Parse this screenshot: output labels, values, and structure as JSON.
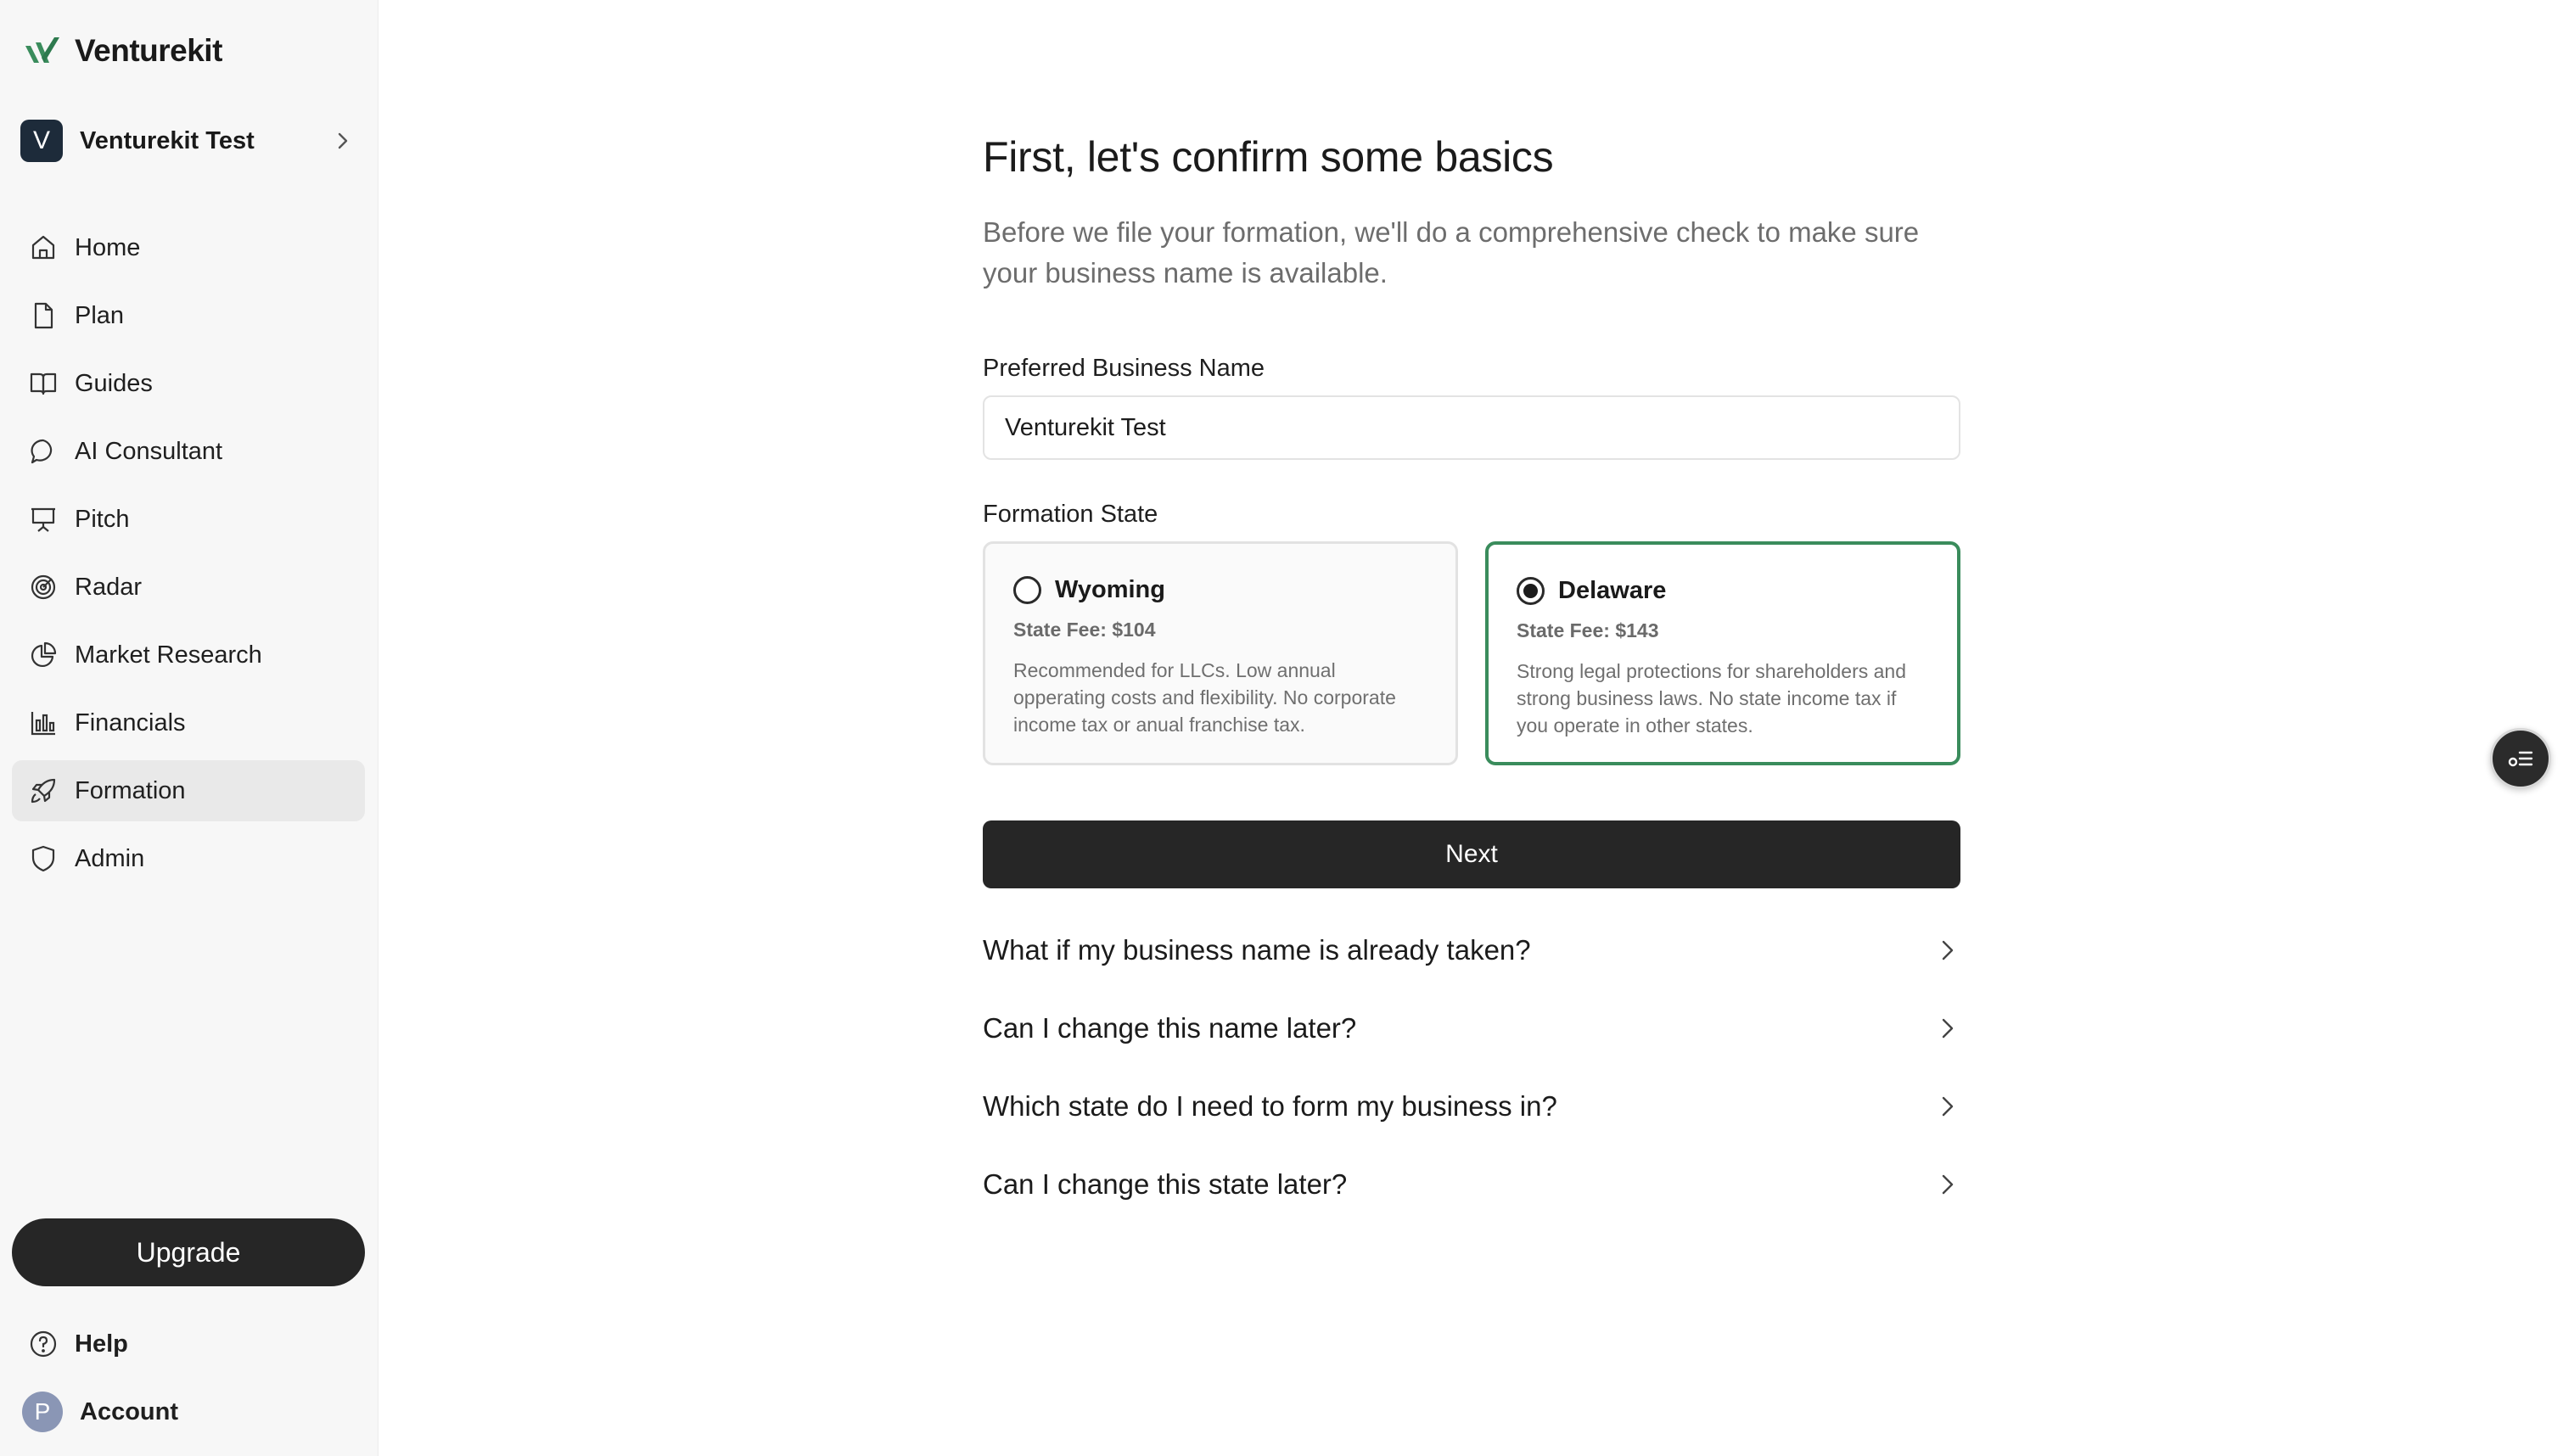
{
  "brand": {
    "name": "Venturekit",
    "accent": "#3a8c5c"
  },
  "workspace": {
    "initial": "V",
    "name": "Venturekit Test"
  },
  "sidebar": {
    "items": [
      {
        "label": "Home",
        "icon": "home-icon"
      },
      {
        "label": "Plan",
        "icon": "document-icon"
      },
      {
        "label": "Guides",
        "icon": "book-icon"
      },
      {
        "label": "AI Consultant",
        "icon": "chat-icon"
      },
      {
        "label": "Pitch",
        "icon": "presentation-icon"
      },
      {
        "label": "Radar",
        "icon": "radar-icon"
      },
      {
        "label": "Market Research",
        "icon": "pie-chart-icon"
      },
      {
        "label": "Financials",
        "icon": "bar-chart-icon"
      },
      {
        "label": "Formation",
        "icon": "rocket-icon",
        "active": true
      },
      {
        "label": "Admin",
        "icon": "shield-icon"
      }
    ],
    "upgrade_label": "Upgrade",
    "help_label": "Help",
    "account": {
      "initial": "P",
      "label": "Account"
    }
  },
  "main": {
    "title": "First, let's confirm some basics",
    "subtitle": "Before we file your formation, we'll do a comprehensive check to make sure your business name is available.",
    "name_field": {
      "label": "Preferred Business Name",
      "value": "Venturekit Test"
    },
    "state_field": {
      "label": "Formation State",
      "options": [
        {
          "name": "Wyoming",
          "fee": "State Fee: $104",
          "description": "Recommended for LLCs. Low annual opperating costs and flexibility. No corporate income tax or anual franchise tax.",
          "selected": false
        },
        {
          "name": "Delaware",
          "fee": "State Fee: $143",
          "description": "Strong legal protections for shareholders and strong business laws. No state income tax if you operate in other states.",
          "selected": true
        }
      ]
    },
    "next_label": "Next",
    "faq": [
      "What if my business name is already taken?",
      "Can I change this name later?",
      "Which state do I need to form my business in?",
      "Can I change this state later?"
    ]
  },
  "floating_button": {
    "icon": "list-settings-icon"
  }
}
